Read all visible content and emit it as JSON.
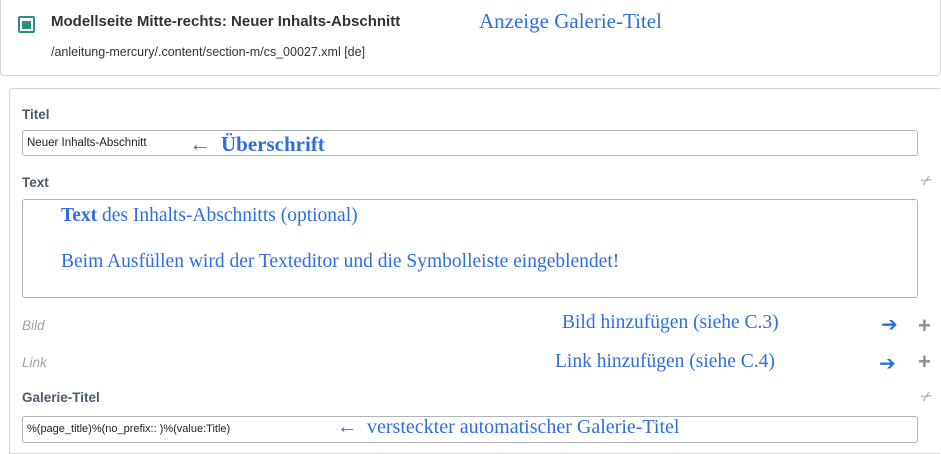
{
  "header": {
    "title": "Modellseite Mitte-rechts: Neuer Inhalts-Abschnitt",
    "path": "/anleitung-mercury/.content/section-m/cs_00027.xml [de]",
    "annotation": "Anzeige Galerie-Titel"
  },
  "form": {
    "titel": {
      "label": "Titel",
      "value": "Neuer Inhalts-Abschnitt",
      "annotation_arrow": "←",
      "annotation": "Überschrift"
    },
    "text": {
      "label": "Text",
      "annotation_bold": "Text",
      "annotation_line1": " des Inhalts-Abschnitts  (optional)",
      "annotation_line2": "Beim Ausfüllen wird der Texteditor und die Symbolleiste eingeblendet!"
    },
    "bild": {
      "label": "Bild",
      "annotation": "Bild hinzufügen (siehe C.3)",
      "arrow": "➔",
      "plus": "+"
    },
    "link": {
      "label": "Link",
      "annotation": "Link hinzufügen (siehe C.4)",
      "arrow": "➔",
      "plus": "+"
    },
    "galerie_titel": {
      "label": "Galerie-Titel",
      "value": "%(page_title)%(no_prefix:: )%(value:Title)",
      "annotation_arrow": "←",
      "annotation": "versteckter automatischer Galerie-Titel"
    }
  },
  "icons": {
    "header": "content-section-icon",
    "remove": "scissors-icon",
    "add": "plus-icon"
  },
  "colors": {
    "annotation": "#2f6ee0",
    "label": "#4c5b68",
    "header_icon": "#2e8e7e"
  }
}
